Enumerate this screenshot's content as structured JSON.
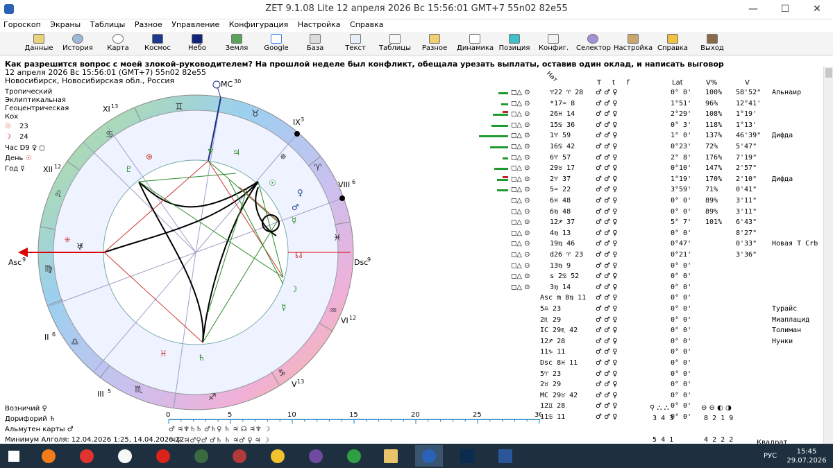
{
  "window": {
    "title": "ZET 9.1.08 Lite    12 апреля 2026   Вс   15:56:01 GMT+7 55n02  82e55",
    "minimize": "—",
    "maximize": "☐",
    "close": "✕"
  },
  "menu": [
    "Гороскоп",
    "Экраны",
    "Таблицы",
    "Разное",
    "Управление",
    "Конфигурация",
    "Настройка",
    "Справка"
  ],
  "toolbar": [
    "Данные",
    "История",
    "Карта",
    "Космос",
    "Небо",
    "Земля",
    "Google",
    "База",
    "Текст",
    "Таблицы",
    "Разное",
    "Динамика",
    "Позиция",
    "Конфиг.",
    "Селектор",
    "Настройка",
    "Справка",
    "Выход"
  ],
  "question": "Как разрешится вопрос с моей злокой-руководителем? На прошлой неделе был конфликт, обещала урезать выплаты, оставив один оклад, и написать выговор",
  "header": {
    "datetime": "12 апреля 2026  Вс  15:56:01 (GMT+7) 55n02  82e55",
    "place": "Новосибирск, Новосибирская обл., Россия"
  },
  "side": {
    "zodiac": "Тропический",
    "coords": "Эклиптикальная",
    "center": "Геоцентрическая",
    "houses": "Кох",
    "sun_day": "23",
    "moon_day": "24",
    "hour": "Час D9",
    "day": "День",
    "year": "Год",
    "vozn": "Возничий",
    "dorif": "Дорифорий",
    "almuten": "Альмутен карты",
    "min_algol": "Минимум Алголя: 12.04.2026  1:25,  14.04.2026 22:"
  },
  "chart_labels": {
    "mc": "MC",
    "mc_deg": "30",
    "asc": "Asc",
    "asc_deg": "9",
    "dsc": "Dsc",
    "dsc_deg": "9",
    "h2": "II",
    "h2_deg": "6",
    "h3": "III",
    "h3_deg": "5",
    "h5": "V",
    "h5_deg": "13",
    "h6": "VI",
    "h6_deg": "12",
    "h8": "VIII",
    "h8_deg": "6",
    "h9": "IX",
    "h9_deg": "3",
    "h11": "XI",
    "h11_deg": "13",
    "h12": "XII",
    "h12_deg": "12"
  },
  "scale": {
    "ticks": [
      "0",
      "5",
      "10",
      "15",
      "20",
      "25",
      "30"
    ]
  },
  "table": {
    "head": [
      "Нат",
      "T",
      "t",
      "f",
      "Lat",
      "V%",
      "V"
    ],
    "rows": [
      {
        "pos": "♈22 ♈ 28",
        "lat": "0° 0'",
        "vpct": "100%",
        "v": "58'52\"",
        "star": "Альнаир"
      },
      {
        "pos": "*17♒ 8",
        "lat": "1°51'",
        "vpct": "96%",
        "v": "12°41'",
        "star": ""
      },
      {
        "pos": "26♓ 14",
        "lat": "2°29'",
        "vpct": "108%",
        "v": "1°19'",
        "star": ""
      },
      {
        "pos": "15♋ 36",
        "lat": "0° 3'",
        "vpct": "118%",
        "v": "1°13'",
        "star": ""
      },
      {
        "pos": "1♈ 59",
        "lat": "1° 0'",
        "vpct": "137%",
        "v": "46'39\"",
        "star": "Дифда"
      },
      {
        "pos": "16♋ 42",
        "lat": "0°23'",
        "vpct": "72%",
        "v": "5'47\"",
        "star": ""
      },
      {
        "pos": "6♈ 57",
        "lat": "2° 8'",
        "vpct": "176%",
        "v": "7'19\"",
        "star": ""
      },
      {
        "pos": "29♉ 17",
        "lat": "0°10'",
        "vpct": "147%",
        "v": "2'57\"",
        "star": ""
      },
      {
        "pos": "2♈ 37",
        "lat": "1°19'",
        "vpct": "170%",
        "v": "2'10\"",
        "star": "Дифда"
      },
      {
        "pos": "5♒ 22",
        "lat": "3°59'",
        "vpct": "71%",
        "v": "0'41\"",
        "star": ""
      },
      {
        "pos": "6♓ 48",
        "lat": "0° 0'",
        "vpct": "89%",
        "v": "3'11\"",
        "star": ""
      },
      {
        "pos": "6♍ 48",
        "lat": "0° 0'",
        "vpct": "89%",
        "v": "3'11\"",
        "star": ""
      },
      {
        "pos": "12♐ 37",
        "lat": "5° 7'",
        "vpct": "101%",
        "v": "6'43\"",
        "star": ""
      },
      {
        "pos": "4♍ 13",
        "lat": "0° 0'",
        "vpct": "",
        "v": "8'27\"",
        "star": ""
      },
      {
        "pos": "19♍ 46",
        "lat": "0°47'",
        "vpct": "",
        "v": "0'33\"",
        "star": "Новая Т Crb"
      },
      {
        "pos": "d26 ♈ 23",
        "lat": "0°21'",
        "vpct": "",
        "v": "3'36\"",
        "star": ""
      },
      {
        "pos": "13♍ 9",
        "lat": "0° 0'",
        "vpct": "",
        "v": "",
        "star": ""
      },
      {
        "pos": "s 2♋ 52",
        "lat": "0° 0'",
        "vpct": "",
        "v": "",
        "star": ""
      },
      {
        "pos": "3♍ 14",
        "lat": "0° 0'",
        "vpct": "",
        "v": "",
        "star": ""
      },
      {
        "pos": "Asc m 8♍ 11",
        "lat": "0° 0'",
        "vpct": "",
        "v": "",
        "star": ""
      },
      {
        "pos": "5♎ 23",
        "lat": "0° 0'",
        "vpct": "",
        "v": "",
        "star": "Турайс"
      },
      {
        "pos": "2♏ 29",
        "lat": "0° 0'",
        "vpct": "",
        "v": "",
        "star": "Миаплацид"
      },
      {
        "pos": "IC 29♏ 42",
        "lat": "0° 0'",
        "vpct": "",
        "v": "",
        "star": "Толиман"
      },
      {
        "pos": "12♐ 28",
        "lat": "0° 0'",
        "vpct": "",
        "v": "",
        "star": "Нунки"
      },
      {
        "pos": "11♑ 11",
        "lat": "0° 0'",
        "vpct": "",
        "v": "",
        "star": ""
      },
      {
        "pos": "Dsc 8♓ 11",
        "lat": "0° 0'",
        "vpct": "",
        "v": "",
        "star": ""
      },
      {
        "pos": "5♈ 23",
        "lat": "0° 0'",
        "vpct": "",
        "v": "",
        "star": ""
      },
      {
        "pos": "2♉ 29",
        "lat": "0° 0'",
        "vpct": "",
        "v": "",
        "star": ""
      },
      {
        "pos": "MC 29♉ 42",
        "lat": "0° 0'",
        "vpct": "",
        "v": "",
        "star": ""
      },
      {
        "pos": "12♊ 28",
        "lat": "0° 0'",
        "vpct": "",
        "v": "",
        "star": ""
      },
      {
        "pos": "11♋ 11",
        "lat": "0° 0'",
        "vpct": "",
        "v": "",
        "star": ""
      }
    ],
    "counts_a": [
      "3",
      "4",
      "3"
    ],
    "counts_b": [
      "5",
      "4",
      "1"
    ],
    "counts_c": [
      "8",
      "2",
      "1",
      "9"
    ],
    "counts_d": [
      "4",
      "2",
      "2",
      "2"
    ],
    "kvadrat": "Квадрат"
  },
  "taskbar": {
    "time": "15:45",
    "date": "29.07.2026",
    "lang": "РУС"
  }
}
